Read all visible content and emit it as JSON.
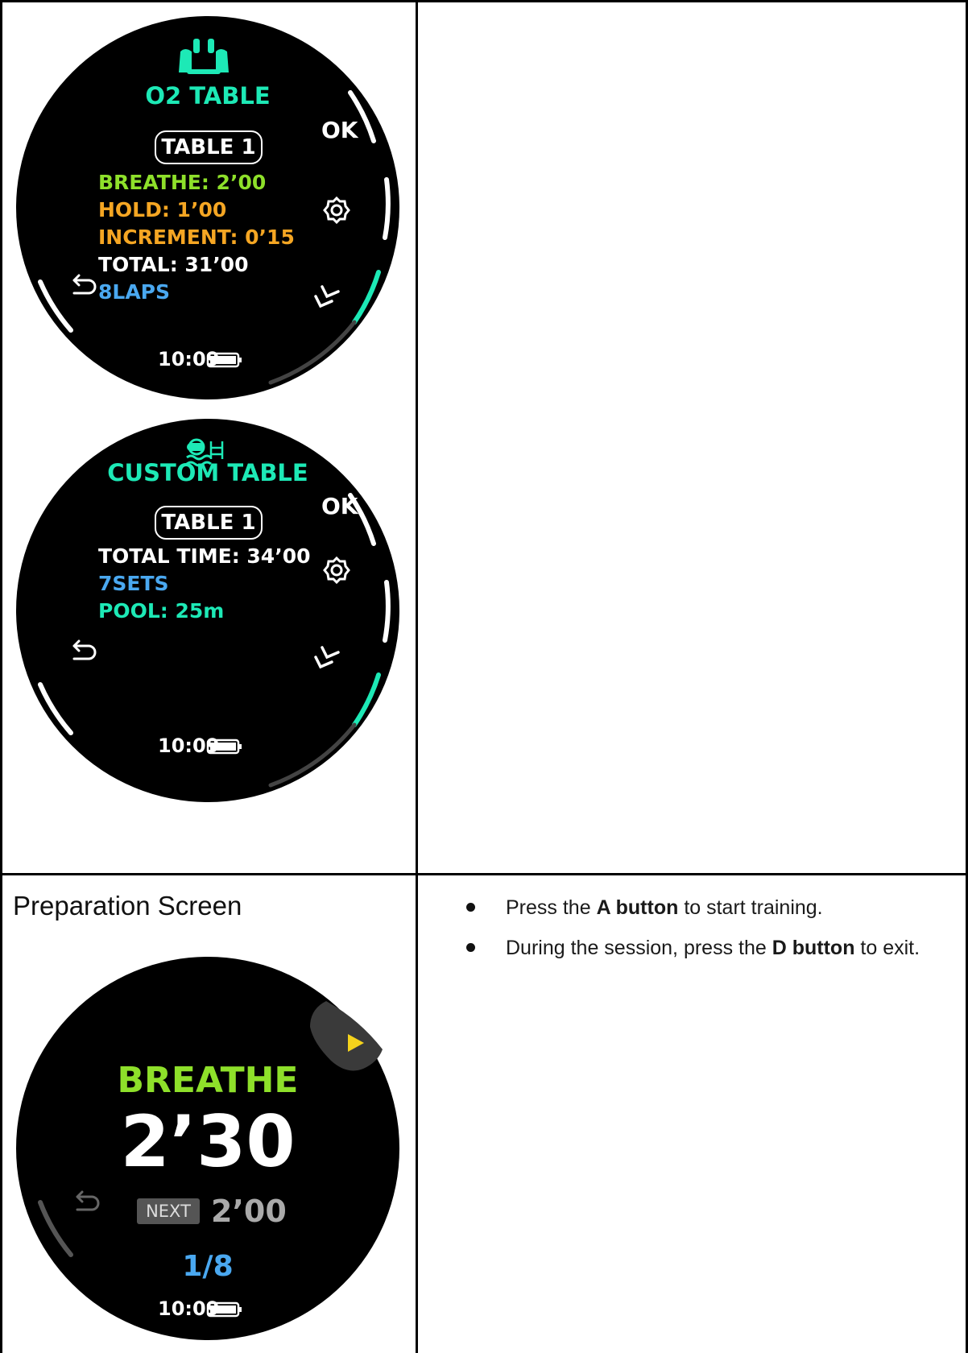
{
  "watch1": {
    "title": "O2 TABLE",
    "table_label": "TABLE 1",
    "breathe": "BREATHE: 2’00",
    "hold": "HOLD: 1’00",
    "increment": "INCREMENT: 0’15",
    "total": "TOTAL: 31’00",
    "laps": "8LAPS",
    "ok_label": "OK",
    "time": "10:09",
    "icon": "lungs-icon"
  },
  "watch2": {
    "title": "CUSTOM TABLE",
    "table_label": "TABLE 1",
    "total_time": "TOTAL TIME: 34’00",
    "sets": "7SETS",
    "pool": "POOL: 25m",
    "ok_label": "OK",
    "time": "10:09",
    "icon": "swimmer-pool-icon"
  },
  "section": {
    "heading": "Preparation Screen",
    "bullet1": {
      "pre": "Press the ",
      "bold": "A button",
      "post": " to start training."
    },
    "bullet2": {
      "pre": "During the session, press the ",
      "bold": "D button",
      "post": " to exit."
    }
  },
  "watch3": {
    "phase": "BREATHE",
    "countdown": "2’30",
    "next_label": "NEXT",
    "next_value": "2’00",
    "progress": "1/8",
    "time": "10:09"
  },
  "colors": {
    "teal": "#1de9b6",
    "green": "#8ee02a",
    "orange": "#f5a623",
    "blue": "#4aa8f0",
    "yellow": "#f5d31c"
  }
}
